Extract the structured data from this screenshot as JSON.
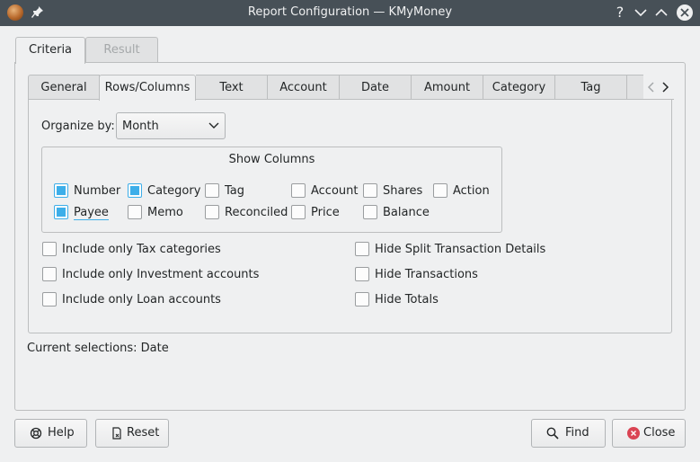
{
  "window": {
    "title": "Report Configuration — KMyMoney",
    "help_glyph": "?"
  },
  "top_tabs": [
    "Criteria",
    "Result"
  ],
  "inner_tabs": [
    "General",
    "Rows/Columns",
    "Text",
    "Account",
    "Date",
    "Amount",
    "Category",
    "Tag"
  ],
  "organize": {
    "label": "Organize by:",
    "value": "Month"
  },
  "show_columns": {
    "title": "Show Columns",
    "items": [
      {
        "label": "Number",
        "checked": true
      },
      {
        "label": "Category",
        "checked": true
      },
      {
        "label": "Tag",
        "checked": false
      },
      {
        "label": "Account",
        "checked": false
      },
      {
        "label": "Shares",
        "checked": false
      },
      {
        "label": "Action",
        "checked": false
      },
      {
        "label": "Payee",
        "checked": true
      },
      {
        "label": "Memo",
        "checked": false
      },
      {
        "label": "Reconciled",
        "checked": false
      },
      {
        "label": "Price",
        "checked": false
      },
      {
        "label": "Balance",
        "checked": false
      }
    ]
  },
  "options": [
    {
      "label": "Include only Tax categories",
      "checked": false
    },
    {
      "label": "Include only Investment accounts",
      "checked": false
    },
    {
      "label": "Include only Loan accounts",
      "checked": false
    },
    {
      "label": "Hide Split Transaction Details",
      "checked": false
    },
    {
      "label": "Hide Transactions",
      "checked": false
    },
    {
      "label": "Hide Totals",
      "checked": false
    }
  ],
  "current_selections": "Current selections: Date",
  "buttons": {
    "help": "Help",
    "reset": "Reset",
    "find": "Find",
    "close": "Close"
  },
  "colors": {
    "accent": "#3daee9",
    "titlebar": "#475057",
    "close_icon": "#da4453"
  }
}
